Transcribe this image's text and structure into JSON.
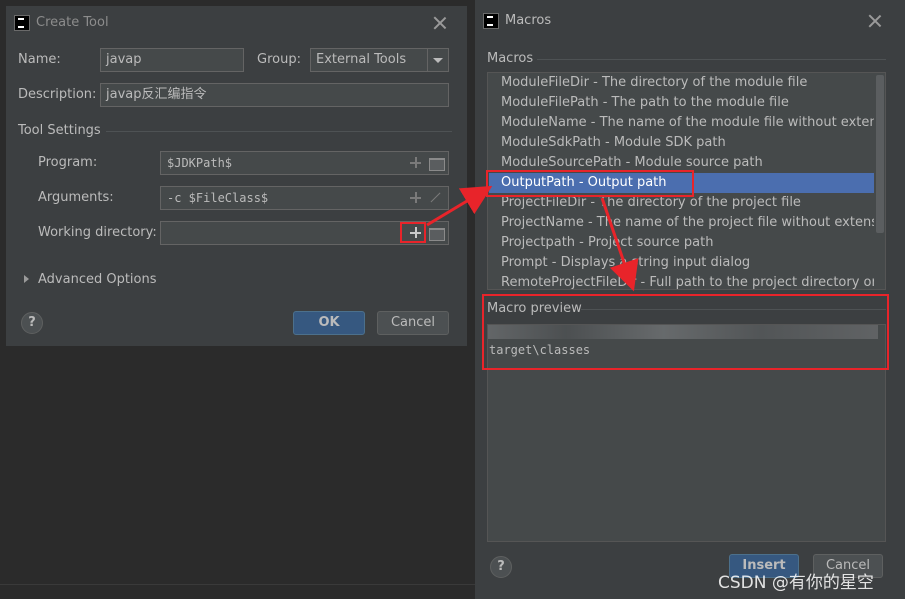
{
  "create_tool": {
    "title": "Create Tool",
    "name_label": "Name:",
    "name_value": "javap",
    "group_label": "Group:",
    "group_value": "External Tools",
    "description_label": "Description:",
    "description_value": "javap反汇编指令",
    "tool_settings_label": "Tool Settings",
    "program_label": "Program:",
    "program_value": "$JDKPath$",
    "arguments_label": "Arguments:",
    "arguments_value": "-c $FileClass$",
    "working_dir_label": "Working directory:",
    "working_dir_value": "",
    "advanced_label": "Advanced Options",
    "ok_label": "OK",
    "cancel_label": "Cancel",
    "help_label": "?"
  },
  "macros": {
    "title": "Macros",
    "section_label": "Macros",
    "items": [
      {
        "label": "ModuleFileDir - The directory of the module file"
      },
      {
        "label": "ModuleFilePath - The path to the module file"
      },
      {
        "label": "ModuleName - The name of the module file without extension"
      },
      {
        "label": "ModuleSdkPath - Module SDK path"
      },
      {
        "label": "ModuleSourcePath - Module source path"
      },
      {
        "label": "OutputPath - Output path",
        "selected": true
      },
      {
        "label": "ProjectFileDir - The directory of the project file"
      },
      {
        "label": "ProjectName - The name of the project file without extension"
      },
      {
        "label": "Projectpath - Project source path"
      },
      {
        "label": "Prompt - Displays a string input dialog"
      },
      {
        "label": "RemoteProjectFileDir - Full path to the project directory on a remote"
      }
    ],
    "preview_label": "Macro preview",
    "preview_value": "target\\classes",
    "insert_label": "Insert",
    "cancel_label": "Cancel",
    "help_label": "?"
  },
  "watermark": "CSDN @有你的星空",
  "colors": {
    "annotation": "#e8242a",
    "selection": "#4b6eaf",
    "primary_button": "#365880"
  }
}
